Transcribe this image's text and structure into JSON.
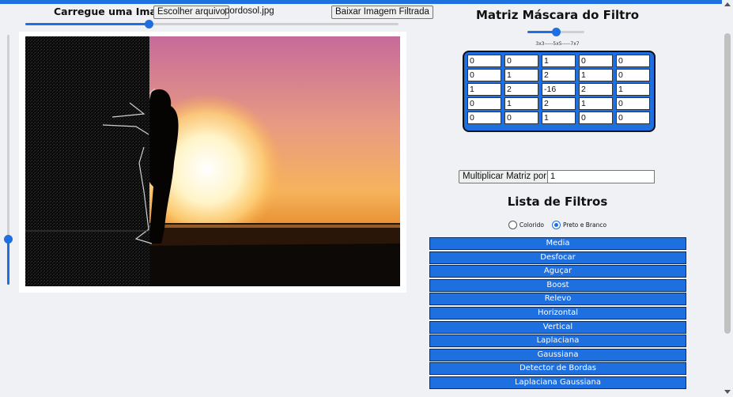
{
  "upload": {
    "label": "Carregue uma Imagem:",
    "choose_button": "Escolher arquivo",
    "file_name": "pordosol.jpg",
    "download_button": "Baixar Imagem Filtrada",
    "split_slider_fraction": 0.33
  },
  "vertical_slider_fraction": 0.18,
  "matrix": {
    "title": "Matriz Máscara do Filtro",
    "size_slider_fraction": 0.5,
    "size_ticks": "3x3-----5x5-----7x7",
    "rows": [
      [
        "0",
        "0",
        "1",
        "0",
        "0"
      ],
      [
        "0",
        "1",
        "2",
        "1",
        "0"
      ],
      [
        "1",
        "2",
        "-16",
        "2",
        "1"
      ],
      [
        "0",
        "1",
        "2",
        "1",
        "0"
      ],
      [
        "0",
        "0",
        "1",
        "0",
        "0"
      ]
    ]
  },
  "multiply": {
    "button": "Multiplicar Matriz por:",
    "value": "1"
  },
  "filters": {
    "title": "Lista de Filtros",
    "radio_color": "Colorido",
    "radio_bw": "Preto e Branco",
    "selected_mode": "Preto e Branco",
    "items": [
      "Media",
      "Desfocar",
      "Aguçar",
      "Boost",
      "Relevo",
      "Horizontal",
      "Vertical",
      "Laplaciana",
      "Gaussiana",
      "Detector de Bordas",
      "Laplaciana Gaussiana"
    ]
  },
  "colors": {
    "accent": "#1e6fe0",
    "background": "#f0f1f4"
  }
}
